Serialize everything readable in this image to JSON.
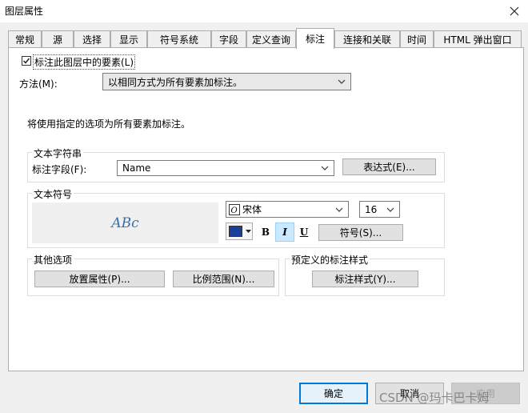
{
  "window": {
    "title": "图层属性"
  },
  "tabs": [
    {
      "label": "常规"
    },
    {
      "label": "源"
    },
    {
      "label": "选择"
    },
    {
      "label": "显示"
    },
    {
      "label": "符号系统"
    },
    {
      "label": "字段"
    },
    {
      "label": "定义查询"
    },
    {
      "label": "标注"
    },
    {
      "label": "连接和关联"
    },
    {
      "label": "时间"
    },
    {
      "label": "HTML 弹出窗口"
    }
  ],
  "label_features": {
    "checked": true,
    "label": "标注此图层中的要素(L)"
  },
  "method": {
    "label": "方法(M):",
    "value": "以相同方式为所有要素加标注。"
  },
  "description": "将使用指定的选项为所有要素加标注。",
  "text_string": {
    "legend": "文本字符串",
    "field_label": "标注字段(F):",
    "field_value": "Name",
    "expression_button": "表达式(E)..."
  },
  "text_symbol": {
    "legend": "文本符号",
    "preview": "ABc",
    "font_name": "宋体",
    "font_size": "16",
    "color": "#1a3e9a",
    "bold": "B",
    "italic": "I",
    "underline": "U",
    "symbol_button": "符号(S)..."
  },
  "other_options": {
    "legend": "其他选项",
    "placement_button": "放置属性(P)...",
    "scale_button": "比例范围(N)..."
  },
  "predefined": {
    "legend": "预定义的标注样式",
    "style_button": "标注样式(Y)..."
  },
  "footer": {
    "ok": "确定",
    "cancel": "取消",
    "apply": "应用"
  },
  "watermark": "CSDN @玛卡巴卡姆"
}
